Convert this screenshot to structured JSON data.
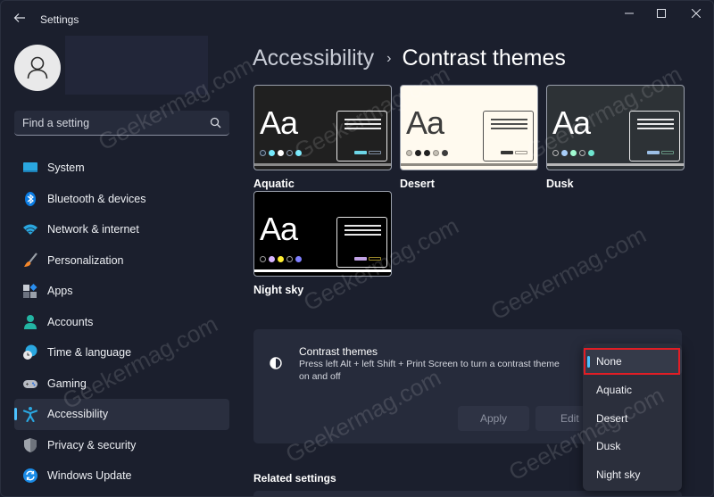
{
  "window": {
    "title": "Settings",
    "controls": {
      "minimize": "—",
      "maximize": "☐",
      "close": "✕"
    }
  },
  "sidebar": {
    "search": {
      "placeholder": "Find a setting"
    },
    "items": [
      {
        "label": "System",
        "icon": "system-icon",
        "active": false
      },
      {
        "label": "Bluetooth & devices",
        "icon": "bluetooth-icon",
        "active": false
      },
      {
        "label": "Network & internet",
        "icon": "wifi-icon",
        "active": false
      },
      {
        "label": "Personalization",
        "icon": "brush-icon",
        "active": false
      },
      {
        "label": "Apps",
        "icon": "apps-icon",
        "active": false
      },
      {
        "label": "Accounts",
        "icon": "accounts-icon",
        "active": false
      },
      {
        "label": "Time & language",
        "icon": "clock-globe-icon",
        "active": false
      },
      {
        "label": "Gaming",
        "icon": "gamepad-icon",
        "active": false
      },
      {
        "label": "Accessibility",
        "icon": "accessibility-icon",
        "active": true
      },
      {
        "label": "Privacy & security",
        "icon": "shield-icon",
        "active": false
      },
      {
        "label": "Windows Update",
        "icon": "update-icon",
        "active": false
      }
    ]
  },
  "breadcrumb": {
    "parent": "Accessibility",
    "separator": "›",
    "current": "Contrast themes"
  },
  "themes": [
    {
      "name": "Aquatic",
      "sample": "Aa",
      "bg": "#202020",
      "fg": "#ffffff",
      "bar": "#8a8a8a",
      "dots": [
        "#1e2a38",
        "#75e9fc",
        "#ffffff",
        "#202020",
        "#75e9fc"
      ],
      "dot_borders": [
        "#8a9bb0",
        "#75e9fc",
        "#ffffff",
        "#8a9bb0",
        "#75e9fc"
      ],
      "btn1": "#75e9fc",
      "btn2_border": "#8a9bb0"
    },
    {
      "name": "Desert",
      "sample": "Aa",
      "bg": "#fffaef",
      "fg": "#3d3d3d",
      "bar": "#8f8b83",
      "dots": [
        "#c5c0b5",
        "#202020",
        "#202020",
        "#c5c0b5",
        "#3d3d3d"
      ],
      "dot_borders": [
        "#8f8b83",
        "#202020",
        "#202020",
        "#8f8b83",
        "#3d3d3d"
      ],
      "btn1": "#202020",
      "btn2_border": "#8f8b83"
    },
    {
      "name": "Dusk",
      "sample": "Aa",
      "bg": "#2d3236",
      "fg": "#ffffff",
      "bar": "#b6b6b6",
      "dots": [
        "#2d3236",
        "#a8cef9",
        "#a1fad0",
        "#2d3236",
        "#6fe5cf"
      ],
      "dot_borders": [
        "#b6b6b6",
        "#a8cef9",
        "#a1fad0",
        "#b6b6b6",
        "#6fe5cf"
      ],
      "btn1": "#a8cef9",
      "btn2_border": "#6c9f8b"
    },
    {
      "name": "Night sky",
      "sample": "Aa",
      "bg": "#000000",
      "fg": "#ffffff",
      "bar": "#ffffff",
      "dots": [
        "#000000",
        "#d6b4fd",
        "#ffee32",
        "#000000",
        "#8080ff"
      ],
      "dot_borders": [
        "#9a9a9a",
        "#d6b4fd",
        "#ffee32",
        "#9a9a9a",
        "#8080ff"
      ],
      "btn1": "#d6b4fd",
      "btn2_border": "#b09a30"
    }
  ],
  "contrast_card": {
    "title": "Contrast themes",
    "description": "Press left Alt + left Shift + Print Screen to turn a contrast theme on and off",
    "apply_label": "Apply",
    "edit_label": "Edit"
  },
  "dropdown": {
    "selected": "None",
    "options": [
      "None",
      "Aquatic",
      "Desert",
      "Dusk",
      "Night sky"
    ]
  },
  "related": {
    "title": "Related settings"
  },
  "watermark": "Geekermag.com",
  "colors": {
    "accent": "#4cc2ff",
    "highlight_box": "#e21d25"
  }
}
